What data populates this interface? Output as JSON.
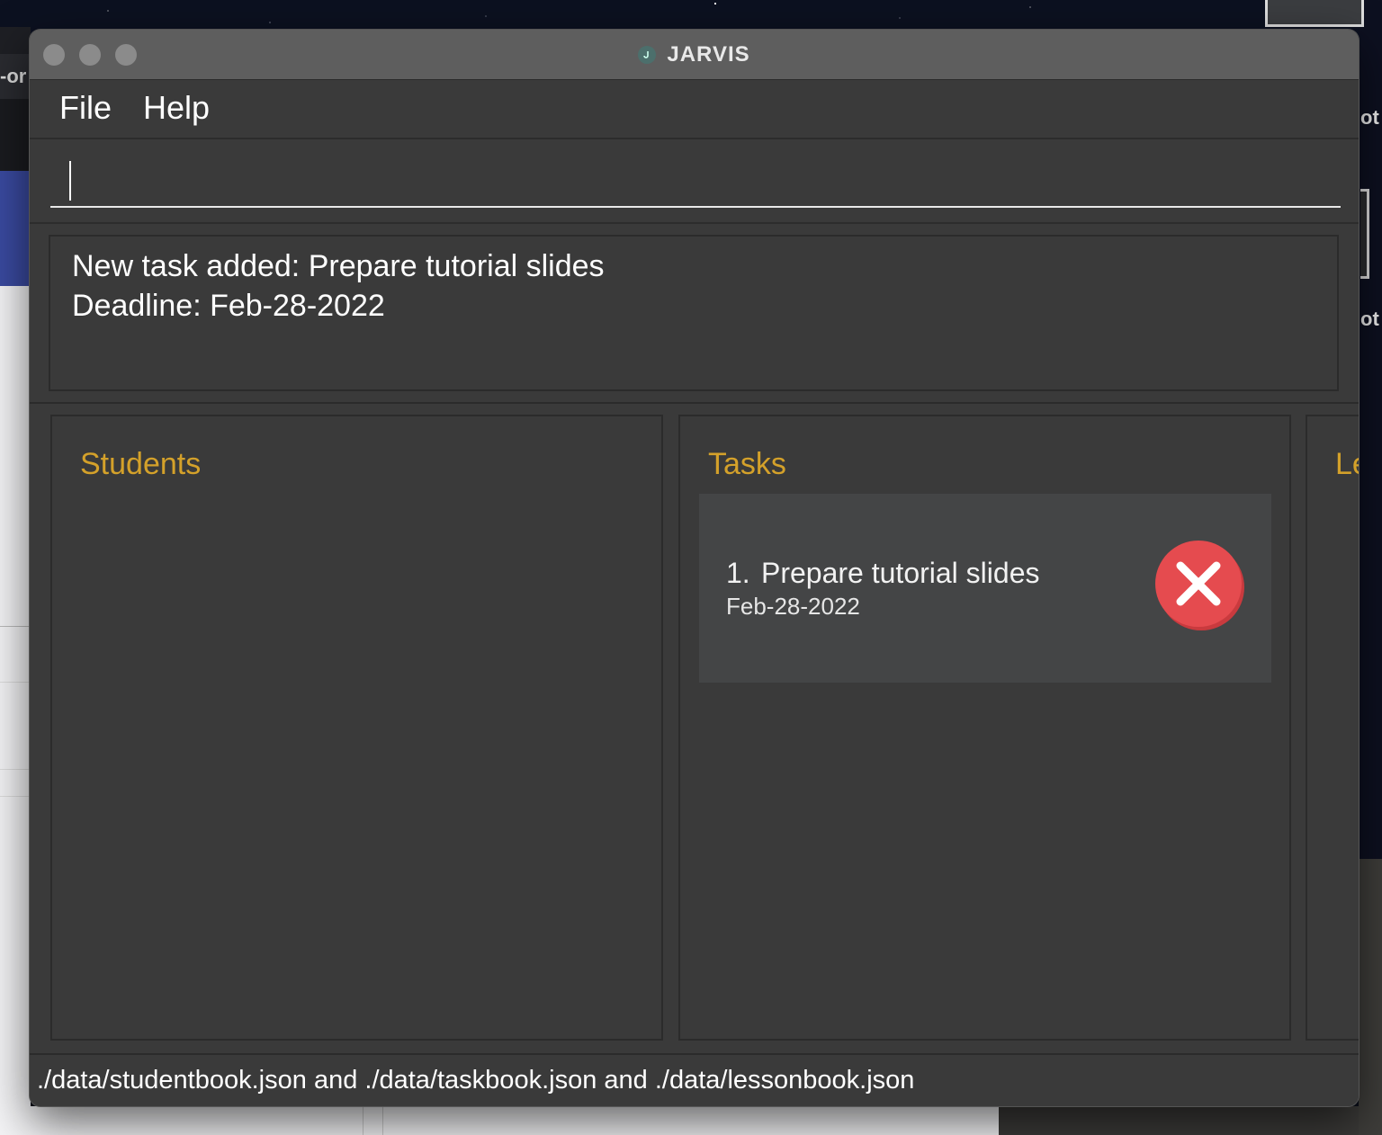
{
  "window": {
    "title": "JARVIS"
  },
  "menu": {
    "file": "File",
    "help": "Help"
  },
  "command": {
    "value": "",
    "placeholder": ""
  },
  "result": {
    "line1": "New task added: Prepare tutorial slides",
    "line2": "Deadline: Feb-28-2022"
  },
  "panels": {
    "students": {
      "title": "Students"
    },
    "tasks": {
      "title": "Tasks",
      "items": [
        {
          "index": "1.",
          "name": "Prepare tutorial slides",
          "deadline": "Feb-28-2022",
          "status_icon": "x-circle-icon"
        }
      ]
    },
    "lessons": {
      "title": "Le"
    }
  },
  "status_bar": {
    "text": "./data/studentbook.json and ./data/taskbook.json and ./data/lessonbook.json"
  },
  "background": {
    "left_text": "-or",
    "right_text1": "ot",
    "right_text2": "ot"
  },
  "colors": {
    "accent_title": "#d4a12a",
    "window_bg": "#3a3a3a",
    "titlebar_bg": "#5e5e5e",
    "delete_red": "#e54b4f"
  }
}
